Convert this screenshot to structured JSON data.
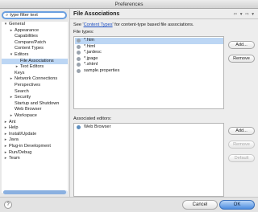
{
  "window": {
    "title": "Preferences"
  },
  "search": {
    "value": "type filter text"
  },
  "tree": [
    {
      "label": "General",
      "twisty": "▾",
      "depth": 0,
      "selected": false
    },
    {
      "label": "Appearance",
      "twisty": "▸",
      "depth": 1,
      "selected": false
    },
    {
      "label": "Capabilities",
      "twisty": "",
      "depth": 1,
      "selected": false
    },
    {
      "label": "Compare/Patch",
      "twisty": "",
      "depth": 1,
      "selected": false
    },
    {
      "label": "Content Types",
      "twisty": "",
      "depth": 1,
      "selected": false
    },
    {
      "label": "Editors",
      "twisty": "▾",
      "depth": 1,
      "selected": false
    },
    {
      "label": "File Associations",
      "twisty": "",
      "depth": 2,
      "selected": true
    },
    {
      "label": "Text Editors",
      "twisty": "▸",
      "depth": 2,
      "selected": false
    },
    {
      "label": "Keys",
      "twisty": "",
      "depth": 1,
      "selected": false
    },
    {
      "label": "Network Connections",
      "twisty": "▸",
      "depth": 1,
      "selected": false
    },
    {
      "label": "Perspectives",
      "twisty": "",
      "depth": 1,
      "selected": false
    },
    {
      "label": "Search",
      "twisty": "",
      "depth": 1,
      "selected": false
    },
    {
      "label": "Security",
      "twisty": "▸",
      "depth": 1,
      "selected": false
    },
    {
      "label": "Startup and Shutdown",
      "twisty": "",
      "depth": 1,
      "selected": false
    },
    {
      "label": "Web Browser",
      "twisty": "",
      "depth": 1,
      "selected": false
    },
    {
      "label": "Workspace",
      "twisty": "▸",
      "depth": 1,
      "selected": false
    },
    {
      "label": "Ant",
      "twisty": "▸",
      "depth": 0,
      "selected": false
    },
    {
      "label": "Help",
      "twisty": "▸",
      "depth": 0,
      "selected": false
    },
    {
      "label": "Install/Update",
      "twisty": "▸",
      "depth": 0,
      "selected": false
    },
    {
      "label": "Java",
      "twisty": "▸",
      "depth": 0,
      "selected": false
    },
    {
      "label": "Plug-in Development",
      "twisty": "▸",
      "depth": 0,
      "selected": false
    },
    {
      "label": "Run/Debug",
      "twisty": "▸",
      "depth": 0,
      "selected": false
    },
    {
      "label": "Team",
      "twisty": "▸",
      "depth": 0,
      "selected": false
    }
  ],
  "page": {
    "title": "File Associations",
    "nav_glyphs": "⇦ ▾ ⇨ ▾",
    "desc_prefix": "See '",
    "desc_link": "Content Types",
    "desc_suffix": "' for content-type based file associations.",
    "file_types_label": "File types:",
    "file_types": [
      {
        "label": "*.htm",
        "icon": "file-icon",
        "selected": true
      },
      {
        "label": "*.html",
        "icon": "file-icon",
        "selected": false
      },
      {
        "label": "*.jardesc",
        "icon": "file-icon",
        "selected": false
      },
      {
        "label": "*.jpage",
        "icon": "file-icon",
        "selected": false
      },
      {
        "label": "*.shtml",
        "icon": "file-icon",
        "selected": false
      },
      {
        "label": "sample.properties",
        "icon": "file-icon",
        "selected": false
      }
    ],
    "add_label": "Add...",
    "remove_label": "Remove",
    "assoc_label": "Associated editors:",
    "editors": [
      {
        "label": "Web Browser",
        "icon": "browser-icon"
      }
    ],
    "add2_label": "Add...",
    "remove2_label": "Remove",
    "default_label": "Default"
  },
  "footer": {
    "help": "?",
    "cancel_label": "Cancel",
    "ok_label": "OK"
  },
  "colors": {
    "selection": "#bcd6f4",
    "ok_button": "#4d8de0",
    "link": "#1c4fc4"
  }
}
